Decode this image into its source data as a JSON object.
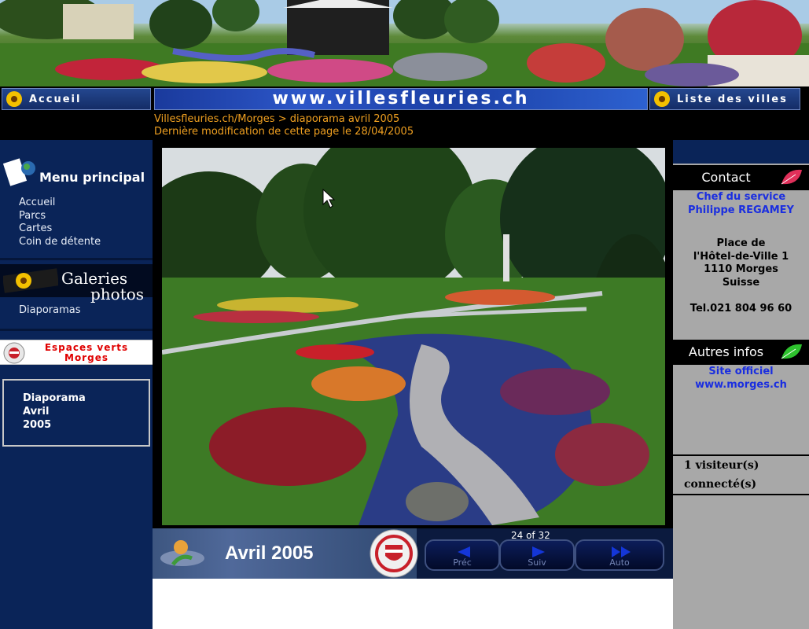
{
  "nav": {
    "home_label": "Accueil",
    "site_url": "www.villesfleuries.ch",
    "towns_label": "Liste des villes"
  },
  "breadcrumb": {
    "path": "Villesfleuries.ch/Morges > diaporama avril 2005",
    "modified": "Dernière modification de cette page le 28/04/2005"
  },
  "sidebar": {
    "menu_title": "Menu principal",
    "menu_items": [
      "Accueil",
      "Parcs",
      "Cartes",
      "Coin de détente"
    ],
    "galleries_line1": "Galeries",
    "galleries_line2": "photos",
    "diaporamas_link": "Diaporamas",
    "espaces_line1": "Espaces verts",
    "espaces_line2": "Morges",
    "current_line1": "Diaporama",
    "current_line2": "Avril",
    "current_line3": "2005"
  },
  "slideshow": {
    "title": "Avril 2005",
    "counter": "24 of 32",
    "prev_label": "Préc",
    "next_label": "Suiv",
    "auto_label": "Auto"
  },
  "contact": {
    "header": "Contact",
    "role": "Chef du service",
    "name": "Philippe REGAMEY",
    "address_line1": "Place de",
    "address_line2": "l'Hôtel-de-Ville 1",
    "address_line3": "1110 Morges",
    "address_line4": "Suisse",
    "phone": "Tel.021 804 96 60"
  },
  "other_info": {
    "header": "Autres infos",
    "link_line1": "Site officiel",
    "link_line2": "www.morges.ch"
  },
  "visitors": {
    "line1": "1 visiteur(s)",
    "line2": "connecté(s)"
  },
  "colors": {
    "nav_blue": "#0a2458",
    "breadcrumb_orange": "#f0a020",
    "contact_link_blue": "#1a2ee0",
    "espaces_red": "#e00000",
    "right_panel_gray": "#a8a8a8"
  },
  "icons": [
    "sunflower-icon",
    "paper-globe-icon",
    "film-flower-icon",
    "morges-crest-icon",
    "pink-leaf-icon",
    "green-leaf-icon",
    "arrow-left-icon",
    "arrow-right-icon",
    "fast-forward-icon"
  ]
}
